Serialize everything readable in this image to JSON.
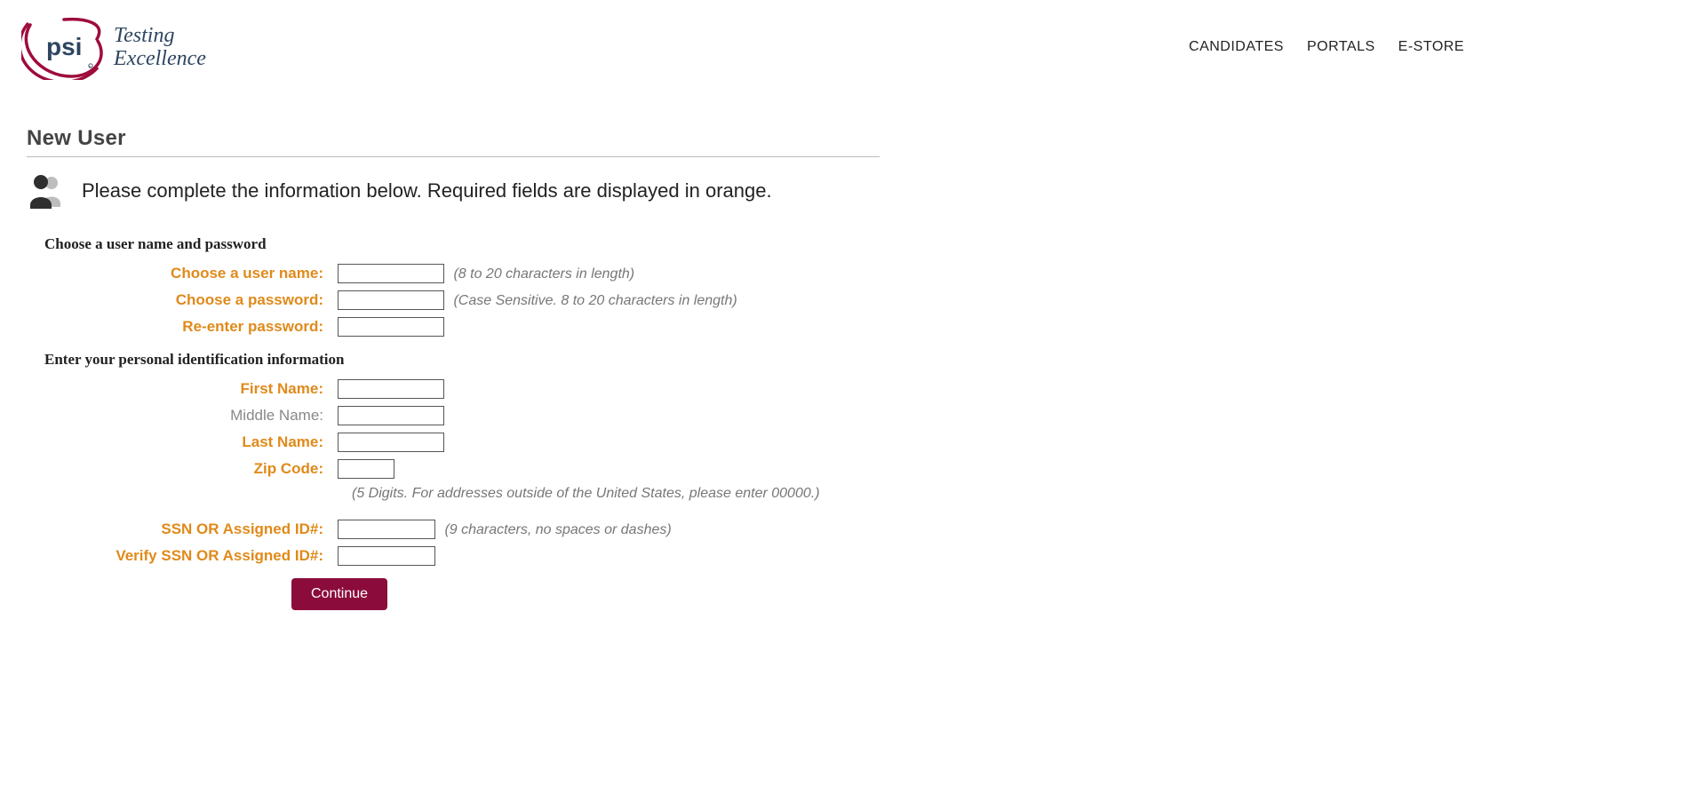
{
  "logo": {
    "brand": "psi",
    "tagline_line1": "Testing",
    "tagline_line2": "Excellence"
  },
  "nav": {
    "candidates": "CANDIDATES",
    "portals": "PORTALS",
    "estore": "E-STORE"
  },
  "page_title": "New User",
  "intro": "Please complete the information below. Required fields are displayed in orange.",
  "section1_head": "Choose a user name and password",
  "section2_head": "Enter your personal identification information",
  "fields": {
    "username": {
      "label": "Choose a user name:",
      "hint": "(8 to 20 characters in length)",
      "value": ""
    },
    "password": {
      "label": "Choose a password:",
      "hint": "(Case Sensitive. 8 to 20 characters in length)",
      "value": ""
    },
    "password2": {
      "label": "Re-enter password:",
      "value": ""
    },
    "firstname": {
      "label": "First Name:",
      "value": ""
    },
    "middlename": {
      "label": "Middle Name:",
      "value": ""
    },
    "lastname": {
      "label": "Last Name:",
      "value": ""
    },
    "zip": {
      "label": "Zip Code:",
      "value": "",
      "hint_below": "(5 Digits. For addresses outside of the United States, please enter 00000.)"
    },
    "ssn": {
      "label": "SSN OR Assigned ID#:",
      "hint": "(9 characters, no spaces or dashes)",
      "value": ""
    },
    "ssn2": {
      "label": "Verify SSN OR Assigned ID#:",
      "value": ""
    }
  },
  "continue_label": "Continue"
}
